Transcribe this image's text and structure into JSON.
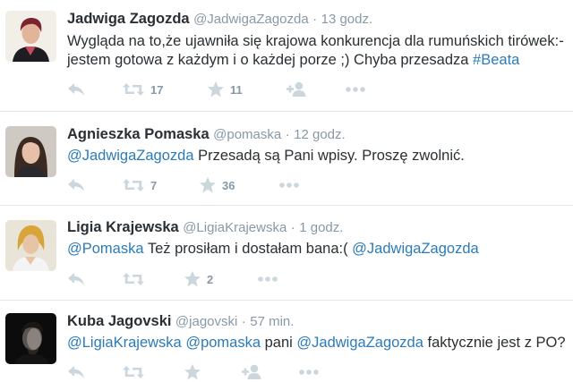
{
  "colors": {
    "link": "#2b7bb9",
    "muted": "#8899a6",
    "icon": "#ccd6dd",
    "text": "#292f33"
  },
  "tweets": [
    {
      "name": "Jadwiga Zagozda",
      "handle": "@JadwigaZagozda",
      "dot": "·",
      "time": "13 godz.",
      "text_a": "Wygląda na to,że ujawniła się krajowa konkurencja dla rumuńskich tirówek:-",
      "text_b": "jestem gotowa z każdym i o każdej porze ;) Chyba przesadza ",
      "hashtag": "#Beata",
      "retweets": "17",
      "favorites": "11",
      "icons": [
        "reply-icon",
        "retweet-icon",
        "favorite-icon",
        "follow-icon",
        "more-icon"
      ]
    },
    {
      "name": "Agnieszka Pomaska",
      "handle": "@pomaska",
      "dot": "·",
      "time": "12 godz.",
      "mention": "@JadwigaZagozda",
      "text": " Przesadą są Pani wpisy. Proszę zwolnić.",
      "retweets": "7",
      "favorites": "36"
    },
    {
      "name": "Ligia Krajewska",
      "handle": "@LigiaKrajewska",
      "dot": "·",
      "time": "1 godz.",
      "mention_a": "@Pomaska",
      "text": " Też prosiłam i dostałam bana:( ",
      "mention_b": "@JadwigaZagozda",
      "favorites": "2"
    },
    {
      "name": "Kuba Jagovski",
      "handle": "@jagovski",
      "dot": "·",
      "time": "57 min.",
      "mention_a": "@LigiaKrajewska",
      "mention_b": "@pomaska",
      "text_a": " pani ",
      "mention_c": "@JadwigaZagozda",
      "text_b": " faktycznie jest z PO?"
    }
  ]
}
